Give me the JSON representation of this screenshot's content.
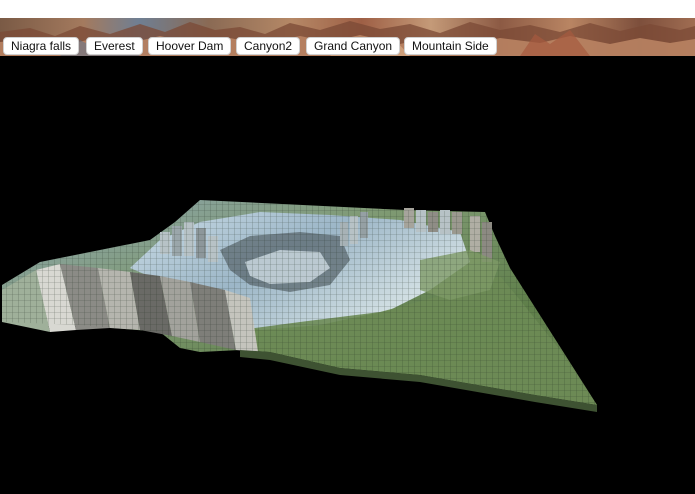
{
  "toolbar": {
    "presets": [
      {
        "label": "Niagra falls"
      },
      {
        "label": "Everest"
      },
      {
        "label": "Hoover Dam"
      },
      {
        "label": "Canyon2"
      },
      {
        "label": "Grand Canyon"
      },
      {
        "label": "Mountain Side"
      }
    ]
  },
  "colors": {
    "background": "#000000",
    "button_bg": "#ffffff",
    "button_text": "#111111",
    "terrain_green": "#6f8f5a",
    "terrain_ice": "#b9cfe0",
    "terrain_rock": "#8a8a86"
  },
  "viewport": {
    "content": "voxel-terrain-3d-view"
  }
}
